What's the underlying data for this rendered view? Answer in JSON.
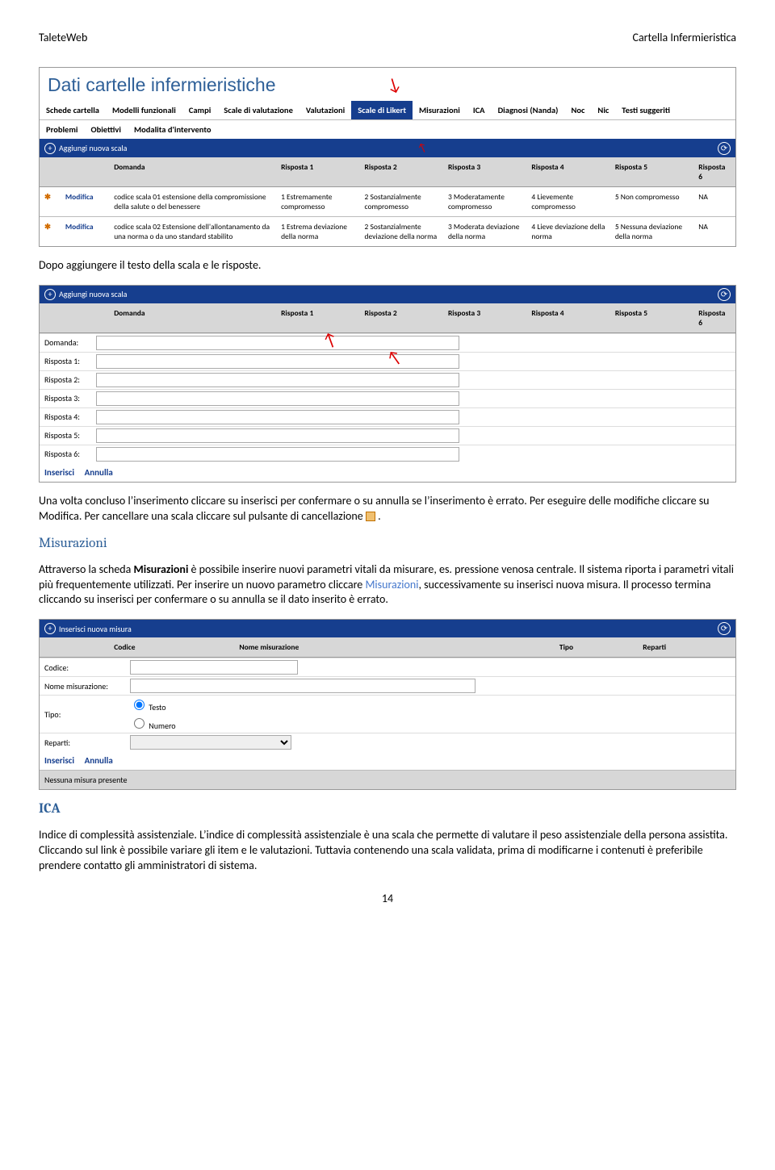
{
  "header": {
    "left": "TaleteWeb",
    "right": "Cartella Infermieristica"
  },
  "panel1": {
    "title": "Dati cartelle infermieristiche",
    "tabs_row1": [
      "Schede cartella",
      "Modelli funzionali",
      "Campi",
      "Scale di valutazione",
      "Valutazioni",
      "Scale di Likert",
      "Misurazioni",
      "ICA",
      "Diagnosi (Nanda)",
      "Noc",
      "Nic",
      "Testi suggeriti"
    ],
    "active_tab": "Scale di Likert",
    "tabs_row2": [
      "Problemi",
      "Obiettivi",
      "Modalita d'intervento"
    ],
    "addbar": "Aggiungi nuova scala",
    "cols": [
      "",
      "",
      "Domanda",
      "Risposta 1",
      "Risposta 2",
      "Risposta 3",
      "Risposta 4",
      "Risposta 5",
      "Risposta 6"
    ],
    "rows": [
      {
        "mod": "Modifica",
        "d": "codice scala 01 estensione della compromissione della salute o del benessere",
        "r1": "1 Estremamente compromesso",
        "r2": "2 Sostanzialmente compromesso",
        "r3": "3 Moderatamente compromesso",
        "r4": "4 Lievemente compromesso",
        "r5": "5 Non compromesso",
        "r6": "NA"
      },
      {
        "mod": "Modifica",
        "d": "codice scala 02 Estensione dell'allontanamento da una norma o da uno standard stabilito",
        "r1": "1 Estrema deviazione della norma",
        "r2": "2 Sostanzialmente deviazione della norma",
        "r3": "3 Moderata deviazione della norma",
        "r4": "4 Lieve deviazione della norma",
        "r5": "5 Nessuna deviazione della norma",
        "r6": "NA"
      }
    ]
  },
  "text1": "Dopo aggiungere il testo della scala e le risposte.",
  "panel2": {
    "addbar": "Aggiungi nuova scala",
    "cols": [
      "",
      "",
      "Domanda",
      "Risposta 1",
      "Risposta 2",
      "Risposta 3",
      "Risposta 4",
      "Risposta 5",
      "Risposta 6"
    ],
    "fields": [
      "Domanda:",
      "Risposta 1:",
      "Risposta 2:",
      "Risposta 3:",
      "Risposta 4:",
      "Risposta 5:",
      "Risposta 6:"
    ],
    "actions": {
      "insert": "Inserisci",
      "cancel": "Annulla"
    }
  },
  "text2": "Una volta concluso l’inserimento cliccare su inserisci per confermare o su annulla se l’inserimento è errato. Per eseguire delle modifiche cliccare su Modifica. Per cancellare una scala cliccare sul pulsante di cancellazione ",
  "h_misurazioni": "Misurazioni",
  "text3a": "Attraverso la scheda ",
  "text3b": "Misurazioni",
  "text3c": " è possibile inserire nuovi parametri vitali da misurare, es. pressione venosa centrale. Il sistema riporta i parametri vitali più frequentemente utilizzati. Per inserire un nuovo parametro cliccare ",
  "text3d": "Misurazioni",
  "text3e": ", successivamente su inserisci nuova misura. Il processo termina cliccando su inserisci per confermare o su annulla se il dato inserito è errato.",
  "panel3": {
    "addbar": "Inserisci nuova misura",
    "cols": [
      "",
      "",
      "Codice",
      "Nome misurazione",
      "Tipo",
      "Reparti"
    ],
    "labels": {
      "codice": "Codice:",
      "nome": "Nome misurazione:",
      "tipo": "Tipo:",
      "reparti": "Reparti:"
    },
    "tipo_opts": [
      "Testo",
      "Numero"
    ],
    "actions": {
      "insert": "Inserisci",
      "cancel": "Annulla"
    },
    "empty": "Nessuna misura presente"
  },
  "h_ica": "ICA",
  "text4": "Indice di complessità assistenziale. L’indice di complessità assistenziale è una scala che permette di valutare il peso assistenziale della persona assistita. Cliccando sul link è possibile variare gli item e le valutazioni. Tuttavia contenendo una scala validata, prima di modificarne i contenuti è preferibile prendere contatto gli amministratori di sistema.",
  "pagenum": "14"
}
